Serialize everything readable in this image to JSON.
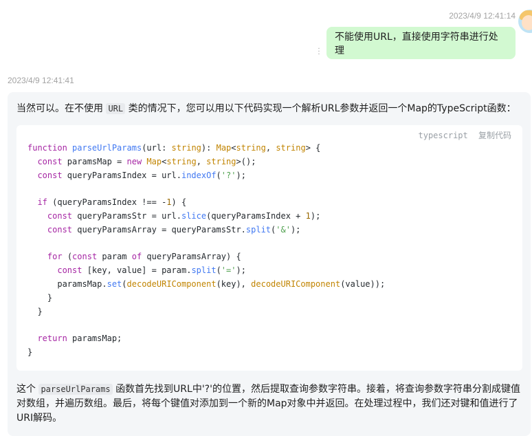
{
  "user_message": {
    "timestamp": "2023/4/9 12:41:14",
    "text": "不能使用URL，直接使用字符串进行处理"
  },
  "bot_message": {
    "timestamp": "2023/4/9 12:41:41",
    "intro_before": "当然可以。在不使用",
    "intro_code": "URL",
    "intro_after": "类的情况下，您可以用以下代码实现一个解析URL参数并返回一个Map的TypeScript函数：",
    "code_language": "typescript",
    "copy_label": "复制代码",
    "code_lines": [
      "function parseUrlParams(url: string): Map<string, string> {",
      "  const paramsMap = new Map<string, string>();",
      "  const queryParamsIndex = url.indexOf('?');",
      "",
      "  if (queryParamsIndex !== -1) {",
      "    const queryParamsStr = url.slice(queryParamsIndex + 1);",
      "    const queryParamsArray = queryParamsStr.split('&');",
      "",
      "    for (const param of queryParamsArray) {",
      "      const [key, value] = param.split('=');",
      "      paramsMap.set(decodeURIComponent(key), decodeURIComponent(value));",
      "    }",
      "  }",
      "",
      "  return paramsMap;",
      "}"
    ],
    "summary_before": "这个",
    "summary_code": "parseUrlParams",
    "summary_after": "函数首先找到URL中'?'的位置，然后提取查询参数字符串。接着，将查询参数字符串分割成键值对数组，并遍历数组。最后，将每个键值对添加到一个新的Map对象中并返回。在处理过程中，我们还对键和值进行了URI解码。"
  },
  "colors": {
    "user_bubble": "#d2f9d1",
    "bot_bubble": "#f4f6f8",
    "keyword": "#a626a4",
    "function": "#4078f2",
    "type": "#c18401",
    "string": "#50a14f"
  },
  "icons": {
    "more": "more-vertical-icon",
    "avatar": "user-avatar"
  }
}
